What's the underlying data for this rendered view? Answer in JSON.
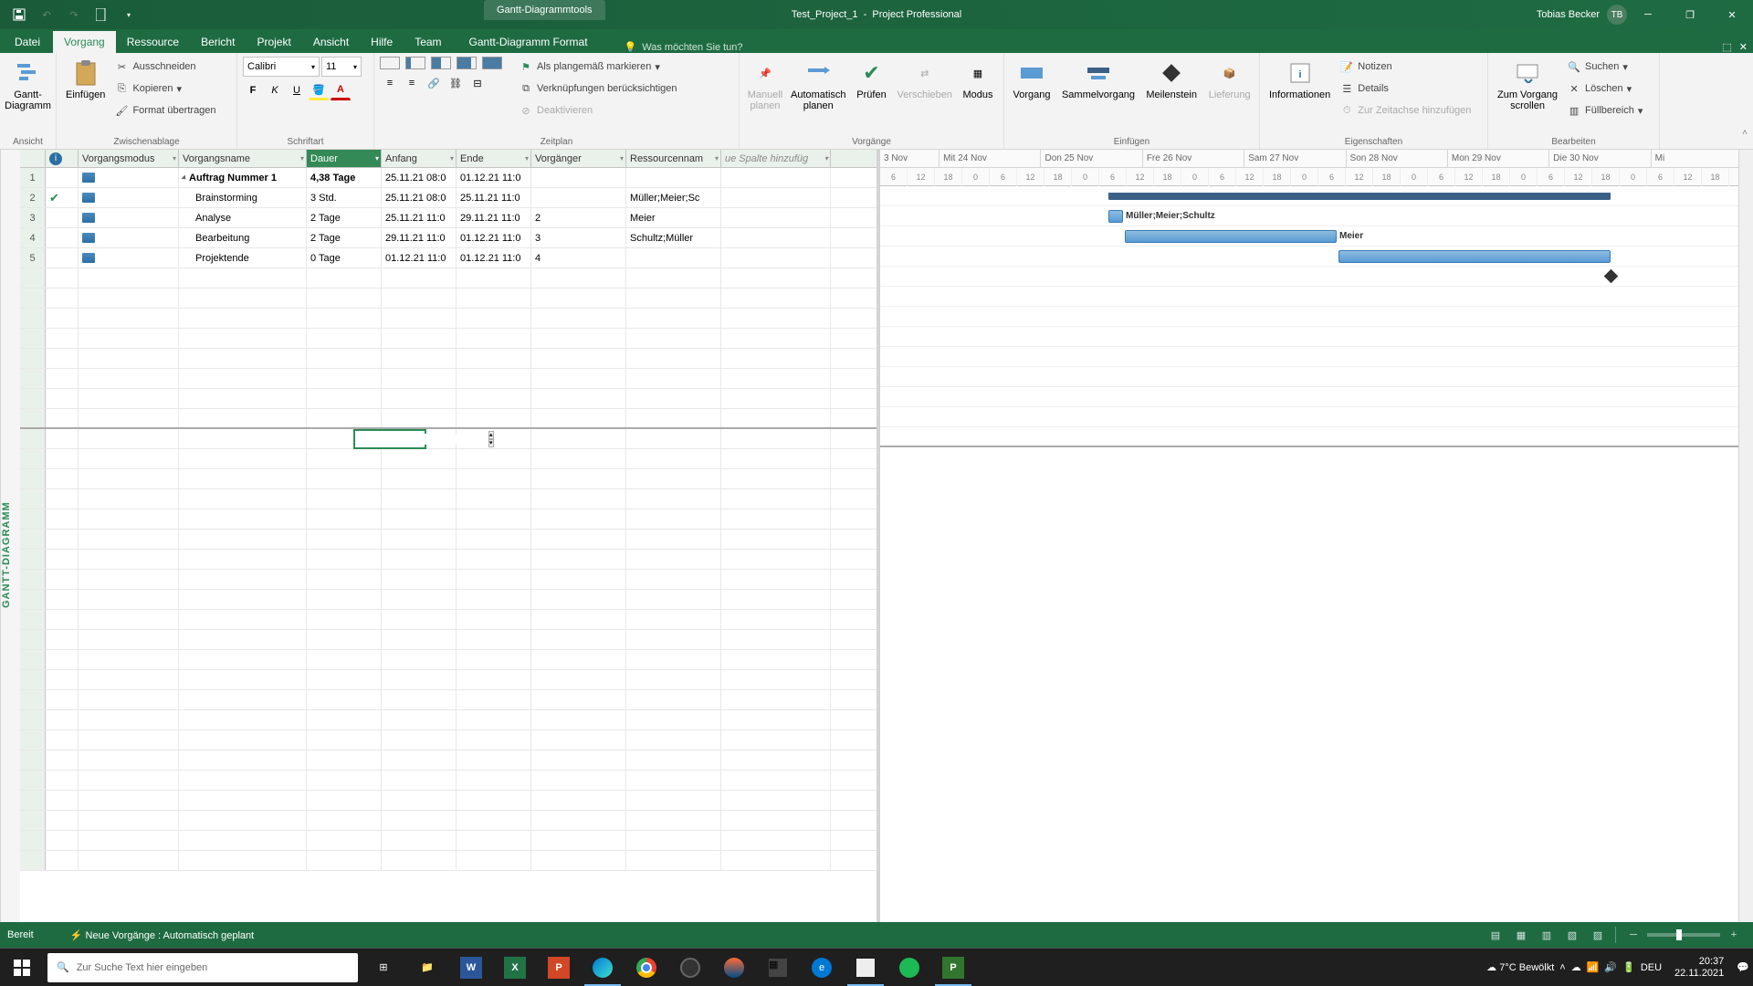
{
  "title": {
    "tool_tab": "Gantt-Diagrammtools",
    "doc": "Test_Project_1",
    "app": "Project Professional",
    "user": "Tobias Becker",
    "initials": "TB"
  },
  "tabs": {
    "file": "Datei",
    "active": "Vorgang",
    "others": [
      "Ressource",
      "Bericht",
      "Projekt",
      "Ansicht",
      "Hilfe",
      "Team"
    ],
    "format": "Gantt-Diagramm Format",
    "tellme": "Was möchten Sie tun?"
  },
  "ribbon": {
    "view": {
      "big": "Gantt-\nDiagramm",
      "label": "Ansicht"
    },
    "clipboard": {
      "paste": "Einfügen",
      "cut": "Ausschneiden",
      "copy": "Kopieren",
      "format": "Format übertragen",
      "label": "Zwischenablage"
    },
    "font": {
      "name": "Calibri",
      "size": "11",
      "label": "Schriftart"
    },
    "schedule": {
      "mark": "Als plangemäß markieren",
      "links": "Verknüpfungen berücksichtigen",
      "deact": "Deaktivieren",
      "label": "Zeitplan"
    },
    "tasks": {
      "manual": "Manuell\nplanen",
      "auto": "Automatisch\nplanen",
      "check": "Prüfen",
      "move": "Verschieben",
      "mode": "Modus",
      "label": "Vorgänge"
    },
    "insert": {
      "task": "Vorgang",
      "summary": "Sammelvorgang",
      "milestone": "Meilenstein",
      "deliv": "Lieferung",
      "label": "Einfügen"
    },
    "props": {
      "info": "Informationen",
      "notes": "Notizen",
      "details": "Details",
      "timeline": "Zur Zeitachse hinzufügen",
      "label": "Eigenschaften"
    },
    "edit": {
      "scroll": "Zum Vorgang\nscrollen",
      "find": "Suchen",
      "del": "Löschen",
      "fill": "Füllbereich",
      "label": "Bearbeiten"
    }
  },
  "columns": {
    "ind": "",
    "mode": "Vorgangsmodus",
    "name": "Vorgangsname",
    "dur": "Dauer",
    "start": "Anfang",
    "end": "Ende",
    "pred": "Vorgänger",
    "res": "Ressourcennam",
    "add": "ue Spalte hinzufüg"
  },
  "rows": [
    {
      "n": "1",
      "name": "Auftrag Nummer 1",
      "dur": "4,38 Tage",
      "start": "25.11.21 08:0",
      "end": "01.12.21 11:0",
      "pred": "",
      "res": "",
      "summary": true,
      "done": false
    },
    {
      "n": "2",
      "name": "Brainstorming",
      "dur": "3 Std.",
      "start": "25.11.21 08:0",
      "end": "25.11.21 11:0",
      "pred": "",
      "res": "Müller;Meier;Sc",
      "done": true
    },
    {
      "n": "3",
      "name": "Analyse",
      "dur": "2 Tage",
      "start": "25.11.21 11:0",
      "end": "29.11.21 11:0",
      "pred": "2",
      "res": "Meier"
    },
    {
      "n": "4",
      "name": "Bearbeitung",
      "dur": "2 Tage",
      "start": "29.11.21 11:0",
      "end": "01.12.21 11:0",
      "pred": "3",
      "res": "Schultz;Müller"
    },
    {
      "n": "5",
      "name": "Projektende",
      "dur": "0 Tage",
      "start": "01.12.21 11:0",
      "end": "01.12.21 11:0",
      "pred": "4",
      "res": ""
    }
  ],
  "timeline": {
    "days": [
      "3 Nov",
      "Mit 24 Nov",
      "Don 25 Nov",
      "Fre 26 Nov",
      "Sam 27 Nov",
      "Son 28 Nov",
      "Mon 29 Nov",
      "Die 30 Nov",
      "Mi"
    ],
    "ticks": [
      "6",
      "12",
      "18",
      "0",
      "6",
      "12",
      "18",
      "0",
      "6",
      "12",
      "18",
      "0",
      "6",
      "12",
      "18",
      "0",
      "6",
      "12",
      "18",
      "0",
      "6",
      "12",
      "18",
      "0",
      "6",
      "12",
      "18",
      "0",
      "6",
      "12",
      "18"
    ]
  },
  "bars": {
    "label1": "Müller;Meier;Schultz",
    "label2": "Meier"
  },
  "status": {
    "ready": "Bereit",
    "mode": "Neue Vorgänge : Automatisch geplant"
  },
  "taskbar": {
    "search": "Zur Suche Text hier eingeben",
    "weather": "7°C  Bewölkt",
    "time": "20:37",
    "date": "22.11.2021",
    "lang": "DEU"
  }
}
